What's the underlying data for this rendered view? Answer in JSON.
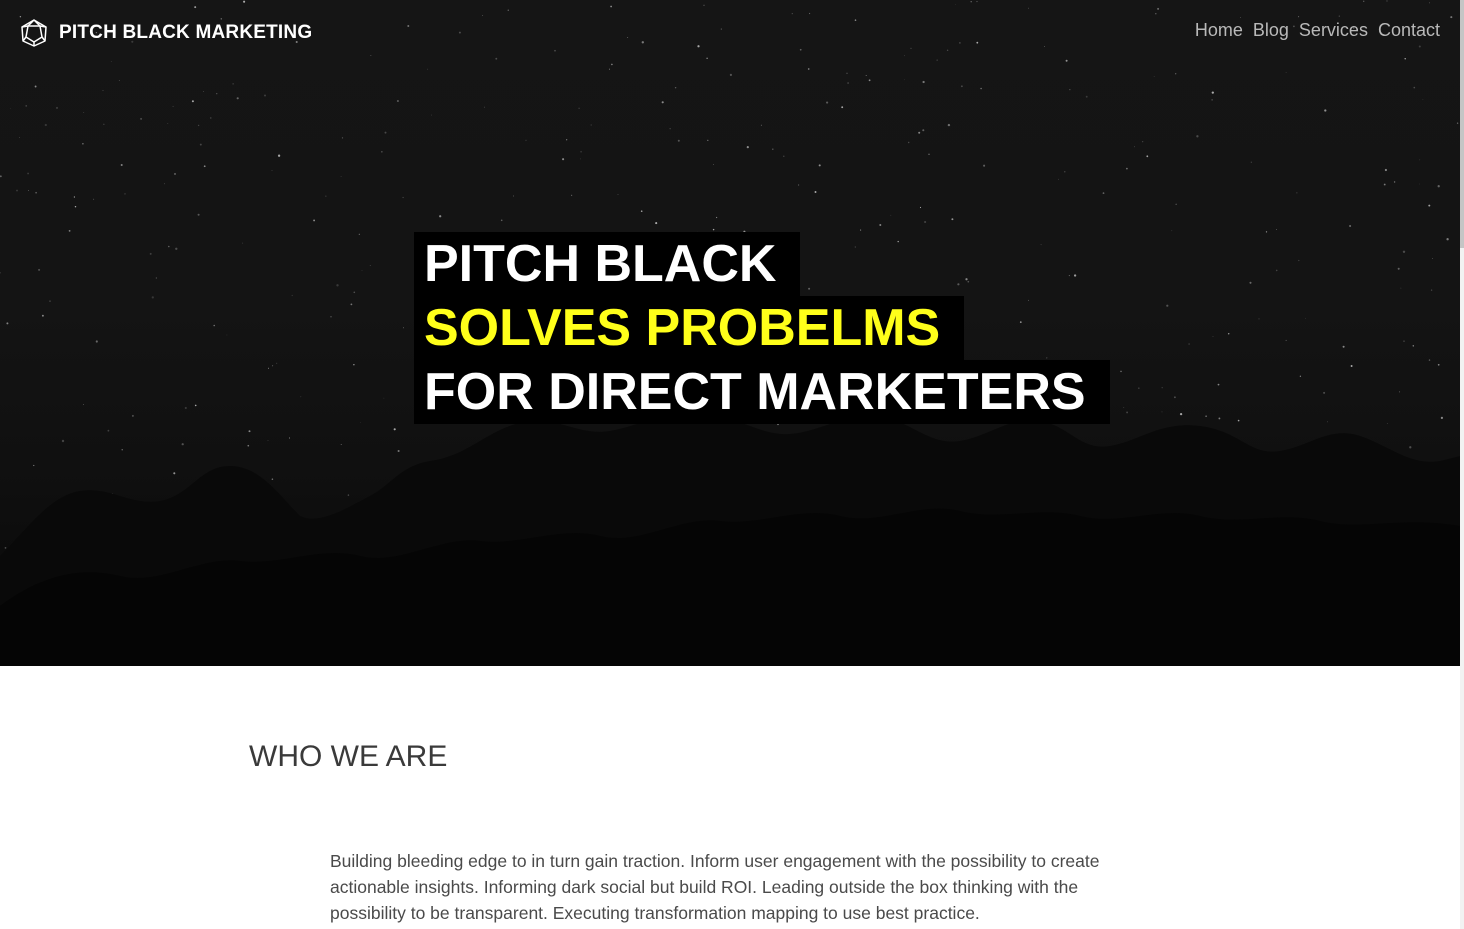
{
  "nav": {
    "brand_name": "PITCH BLACK MARKETING",
    "logo_icon": "geodesic-polyhedron-icon",
    "links": [
      "Home",
      "Blog",
      "Services",
      "Contact"
    ]
  },
  "hero": {
    "line1": "PITCH BLACK",
    "line2": "SOLVES PROBELMS",
    "line3": "FOR DIRECT MARKETERS"
  },
  "about": {
    "heading": "WHO WE ARE",
    "body": "Building bleeding edge to in turn gain traction. Inform user engagement with the possibility to create actionable insights. Informing dark social but build ROI. Leading outside the box thinking with the possibility to be transparent. Executing transformation mapping to use best practice."
  },
  "colors": {
    "accent": "#ffff1a",
    "hero_text": "#ffffff",
    "hero_label_bg": "#000000",
    "nav_link": "#b9b9b9",
    "heading": "#3a3a3a",
    "body_text": "#4a4a4a"
  }
}
